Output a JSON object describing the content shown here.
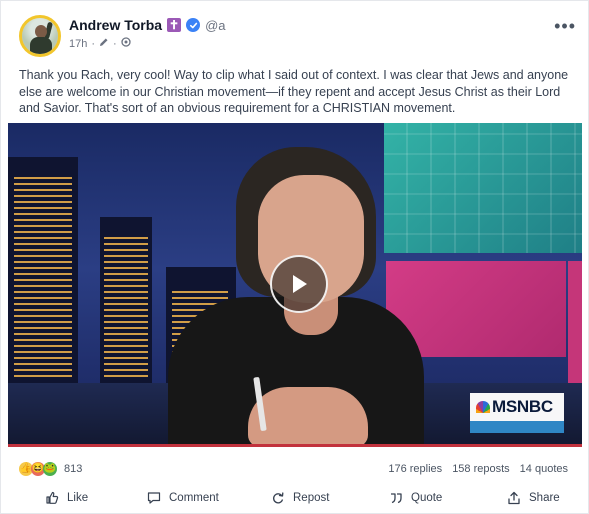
{
  "post": {
    "author_name": "Andrew Torba",
    "author_badge": "✝",
    "handle": "@a",
    "time": "17h",
    "separator": "·",
    "text": "Thank you Rach, very cool! Way to clip what I said out of context. I was clear that Jews and anyone else are welcome in our Christian movement—if they repent and accept Jesus Christ as their Lord and Savior. That's sort of an obvious requirement for a CHRISTIAN movement.",
    "video": {
      "network_logo": "MSNBC"
    }
  },
  "stats": {
    "reactions_count": "813",
    "replies": "176 replies",
    "reposts": "158 reposts",
    "quotes": "14 quotes"
  },
  "actions": {
    "like": "Like",
    "comment": "Comment",
    "repost": "Repost",
    "quote": "Quote",
    "share": "Share"
  },
  "icons": {
    "verified": "verified-check-icon",
    "more": "more-horizontal-icon",
    "privacy": "globe-icon",
    "play": "play-icon"
  },
  "colors": {
    "verified_blue": "#3b82f6",
    "badge_purple": "#9b59b6",
    "progress_red": "#c2323d"
  }
}
